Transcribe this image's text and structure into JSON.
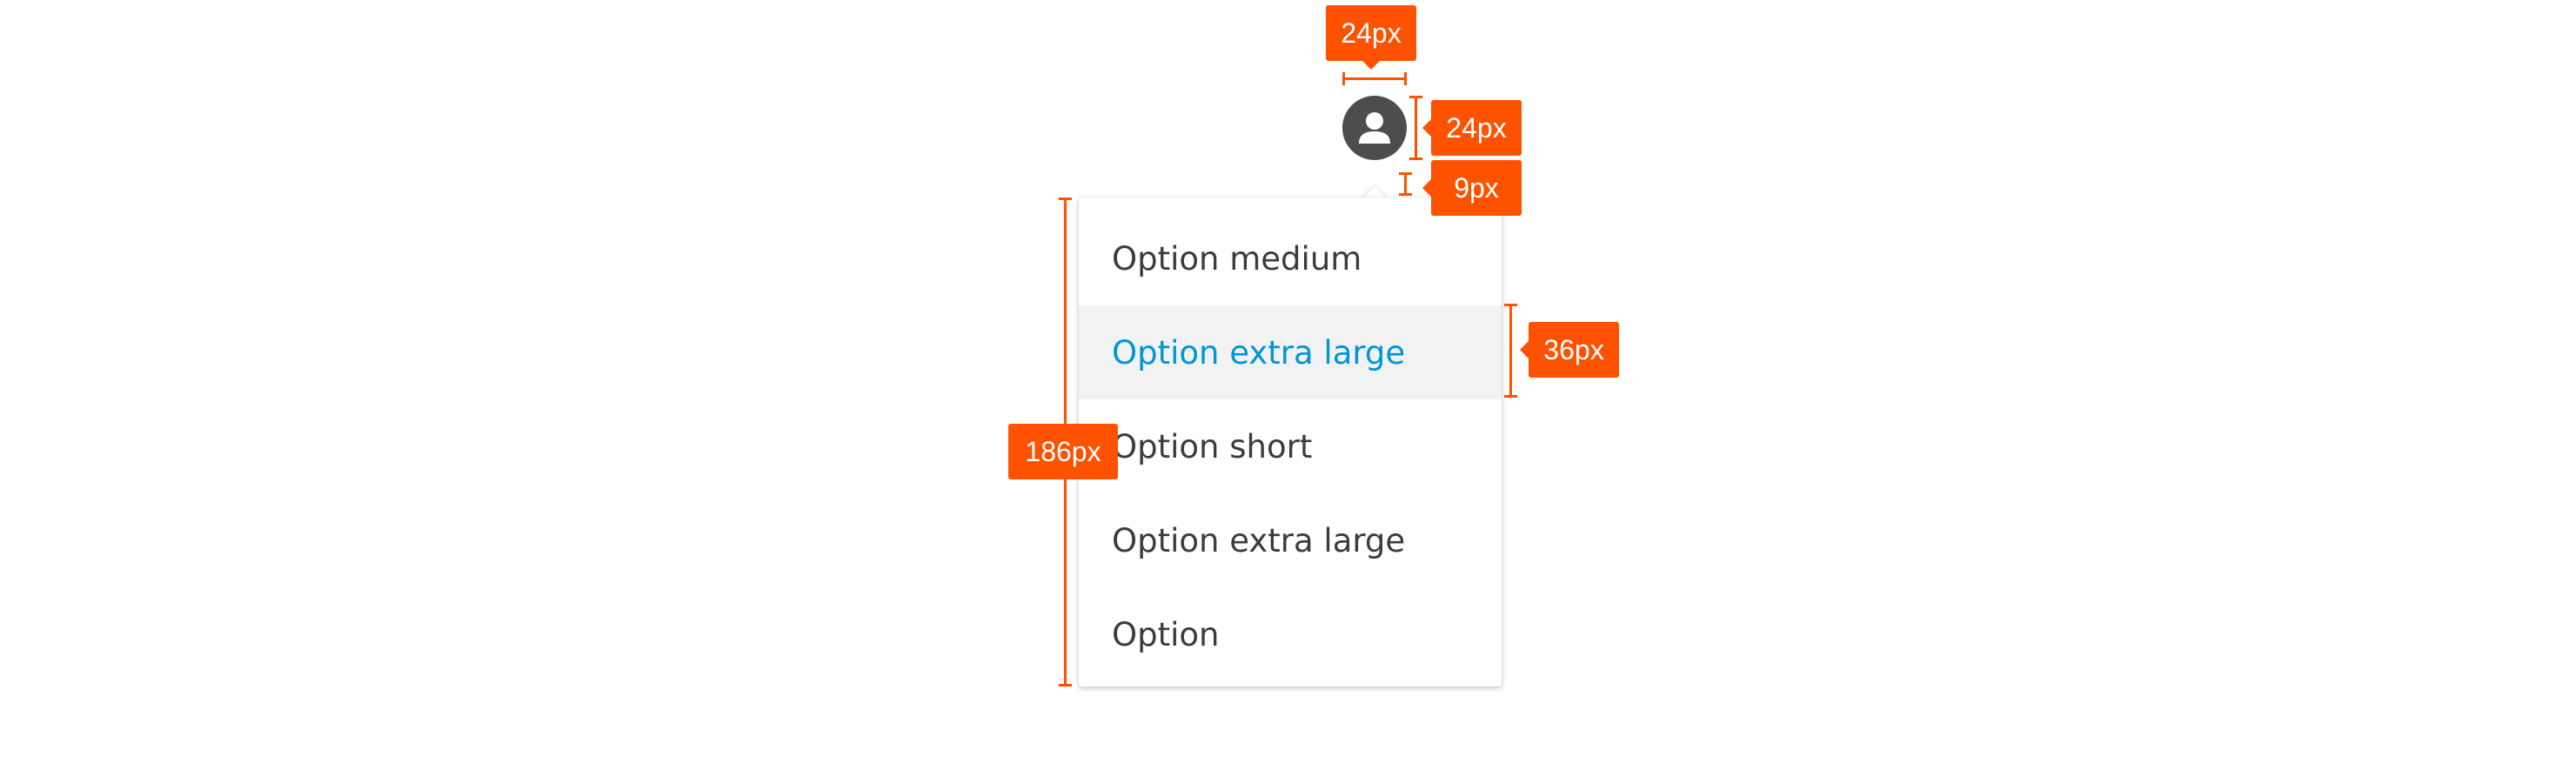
{
  "avatar": {
    "icon": "user-avatar-icon",
    "color": "#4d4d4d"
  },
  "menu": {
    "items": [
      {
        "label": "Option medium",
        "selected": false
      },
      {
        "label": "Option extra large",
        "selected": true
      },
      {
        "label": "Option short",
        "selected": false
      },
      {
        "label": "Option extra large",
        "selected": false
      },
      {
        "label": "Option",
        "selected": false
      }
    ],
    "selected_color": "#0096d6",
    "selected_background": "#f2f2f2",
    "text_color": "#3c3c3c"
  },
  "spec": {
    "accent_color": "#ff5200",
    "avatar_width_label": "24px",
    "avatar_height_label": "24px",
    "gap_label": "9px",
    "item_height_label": "36px",
    "menu_height_label": "186px"
  }
}
